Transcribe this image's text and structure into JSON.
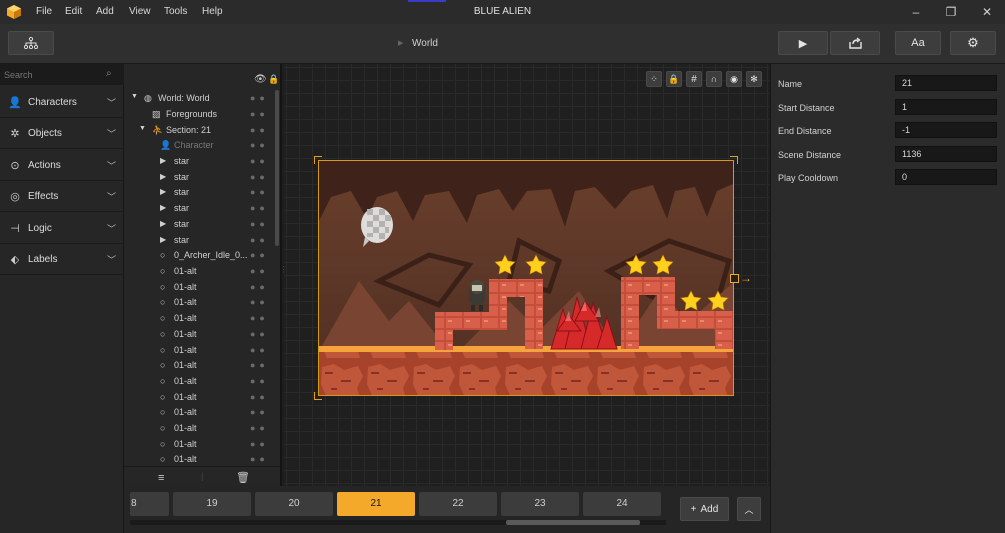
{
  "app": {
    "title": "BLUE ALIEN"
  },
  "menu": [
    "File",
    "Edit",
    "Add",
    "View",
    "Tools",
    "Help"
  ],
  "toolbar": {
    "breadcrumb": "World",
    "font_label": "Aa"
  },
  "search": {
    "placeholder": "Search"
  },
  "categories": [
    {
      "label": "Characters",
      "icon": "person-icon"
    },
    {
      "label": "Objects",
      "icon": "puzzle-icon"
    },
    {
      "label": "Actions",
      "icon": "play-circle-icon"
    },
    {
      "label": "Effects",
      "icon": "swirl-icon"
    },
    {
      "label": "Logic",
      "icon": "logic-icon"
    },
    {
      "label": "Labels",
      "icon": "tag-icon"
    }
  ],
  "tree": {
    "world": "World: World",
    "foregrounds": "Foregrounds",
    "section": "Section: 21",
    "character": "Character",
    "stars": [
      "star",
      "star",
      "star",
      "star",
      "star",
      "star"
    ],
    "archer": "0_Archer_Idle_0...",
    "alts": [
      "01-alt",
      "01-alt",
      "01-alt",
      "01-alt",
      "01-alt",
      "01-alt",
      "01-alt",
      "01-alt",
      "01-alt",
      "01-alt",
      "01-alt",
      "01-alt",
      "01-alt"
    ]
  },
  "properties": [
    {
      "label": "Name",
      "value": "21"
    },
    {
      "label": "Start Distance",
      "value": "1"
    },
    {
      "label": "End Distance",
      "value": "-1"
    },
    {
      "label": "Scene Distance",
      "value": "1136"
    },
    {
      "label": "Play Cooldown",
      "value": "0"
    }
  ],
  "sections": [
    "8",
    "19",
    "20",
    "21",
    "22",
    "23",
    "24"
  ],
  "selected_section": "21",
  "add_label": "Add",
  "colors": {
    "accent": "#f4a92b",
    "scene_border": "#d59818"
  }
}
